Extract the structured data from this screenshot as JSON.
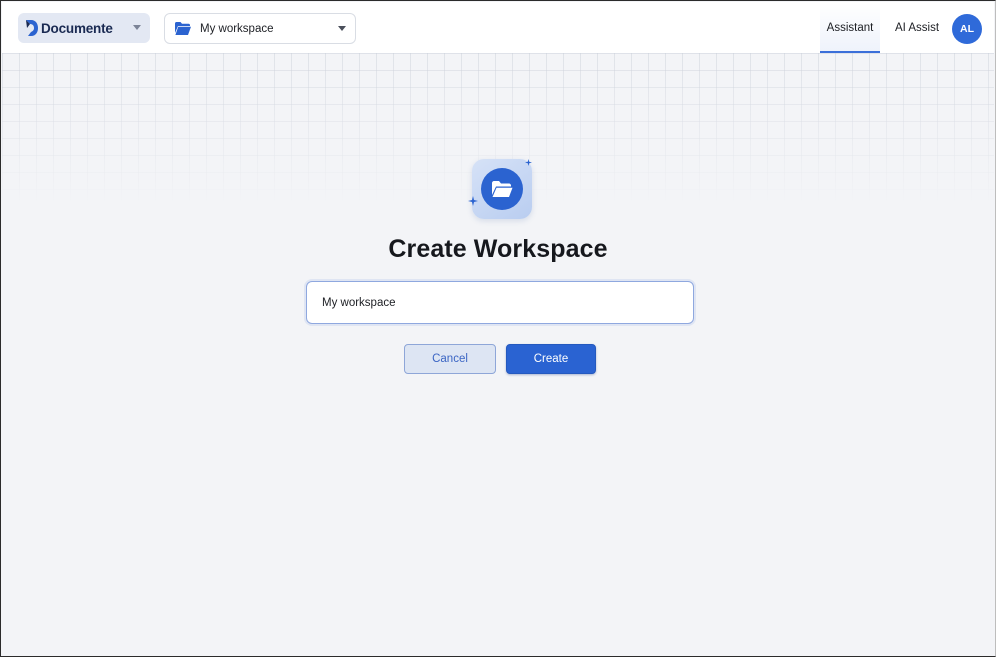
{
  "header": {
    "brand": {
      "name": "Documente",
      "logo_icon": "documente-logo-icon",
      "dropdown_icon": "caret-down-icon"
    },
    "workspace_selector": {
      "label": "My workspace",
      "icon": "folder-icon",
      "dropdown_icon": "caret-down-icon"
    },
    "tabs": [
      {
        "label": "Assistant",
        "active": true
      },
      {
        "label": "AI Assist",
        "active": false
      }
    ],
    "avatar": {
      "initials": "AL",
      "color": "#2f6ad9"
    }
  },
  "main": {
    "icon": "folder-open-icon",
    "title": "Create Workspace",
    "name_input": {
      "value": "My workspace"
    },
    "buttons": {
      "cancel_label": "Cancel",
      "create_label": "Create"
    }
  },
  "colors": {
    "accent": "#2a63d2",
    "background": "#f3f4f7"
  }
}
